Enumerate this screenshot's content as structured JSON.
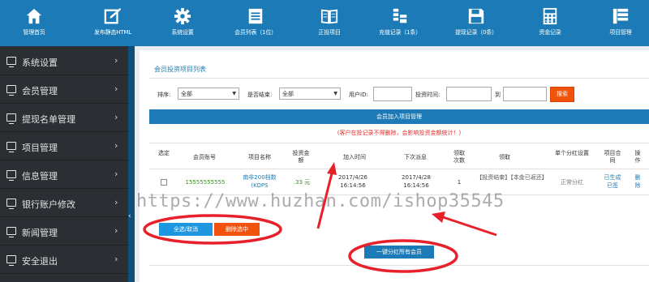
{
  "topnav": [
    {
      "label": "管理首页",
      "icon": "home-icon"
    },
    {
      "label": "发布静态HTML",
      "icon": "edit-icon"
    },
    {
      "label": "系统设置",
      "icon": "gear-icon"
    },
    {
      "label": "会员列表（1位）",
      "icon": "member-list-icon"
    },
    {
      "label": "正投项目",
      "icon": "book-icon"
    },
    {
      "label": "充值记录（1条）",
      "icon": "coins-icon"
    },
    {
      "label": "提现记录（0条）",
      "icon": "floppy-icon"
    },
    {
      "label": "资金记录",
      "icon": "calculator-icon"
    },
    {
      "label": "项目管理",
      "icon": "project-icon"
    }
  ],
  "sidebar": [
    {
      "label": "系统设置"
    },
    {
      "label": "会员管理"
    },
    {
      "label": "提现名单管理"
    },
    {
      "label": "项目管理"
    },
    {
      "label": "信息管理"
    },
    {
      "label": "银行账户修改"
    },
    {
      "label": "新闻管理"
    },
    {
      "label": "安全退出"
    }
  ],
  "sidebar_chevron": "›",
  "collapse_glyph": "‹",
  "page_title": "会员投资项目列表",
  "filters": {
    "sort_label": "排序:",
    "sort_value": "全部",
    "ended_label": "是否结束:",
    "ended_value": "全部",
    "user_label": "用户ID:",
    "time_label": "投资时间:",
    "to_label": "到",
    "search_button": "搜索"
  },
  "table": {
    "title": "会员加入项目管理",
    "notice": "(客户在投记录不得删除，会影响投资金额统计！)",
    "headers": [
      "选定",
      "会员账号",
      "项目名称",
      "投资金额",
      "加入时间",
      "下次派息",
      "领取次数",
      "领取",
      "单个分红设置",
      "项目合同",
      "操作"
    ],
    "row": {
      "account": "15555555555",
      "project": "南非200档数(KOPS",
      "amount": ".33 元",
      "join_time": "2017/4/26 16:14:56",
      "next_payout": "2017/4/28 16:14:56",
      "times": "1",
      "claim": "【投资结束】【本金已返还】",
      "bonus_setting": "正常分红",
      "contract": "已生成 已签",
      "action": "删除"
    }
  },
  "buttons": {
    "select_all": "全选/取消",
    "delete_selected": "删除选中",
    "bonus_all": "一键分红所有会员"
  },
  "watermark": "https://www.huzhan.com/ishop35545",
  "colors": {
    "topbar": "#1c7bb6",
    "sidebar": "#2b2e33",
    "accent_orange": "#f2530c",
    "annotation_red": "#e8202a",
    "green_text": "#3a8f1e"
  }
}
